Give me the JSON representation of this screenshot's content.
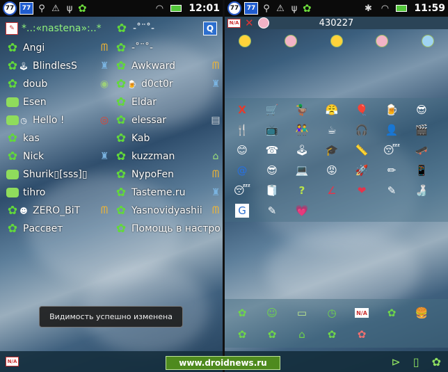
{
  "left": {
    "status": {
      "time": "12:01",
      "badge": "77"
    },
    "header": {
      "self_name": "*..:«nastena»:..*",
      "second_name": "-˚¨˚-",
      "q_label": "Q"
    },
    "column1": [
      {
        "name": "Angi",
        "icon": "icq-flower-online",
        "extra": "mm"
      },
      {
        "name": "BlindlesS",
        "icon": "icq-flower-online",
        "sub": "joystick",
        "extra": "ph"
      },
      {
        "name": "doub",
        "icon": "icq-flower-online",
        "extra": "eye"
      },
      {
        "name": "Esen",
        "icon": "chat-bubble",
        "extra": ""
      },
      {
        "name": "Hello !",
        "icon": "chat-bubble",
        "sub": "clock",
        "extra": "target"
      },
      {
        "name": "kas",
        "icon": "icq-flower-online",
        "extra": ""
      },
      {
        "name": "Nick",
        "icon": "icq-flower-online",
        "extra": "ph"
      },
      {
        "name": "Shurik▯[sss]▯",
        "icon": "chat-bubble",
        "extra": ""
      },
      {
        "name": "tihro",
        "icon": "chat-bubble",
        "extra": ""
      },
      {
        "name": "ZERO_BiT",
        "icon": "icq-flower-online",
        "sub": "smiley",
        "extra": "mm"
      },
      {
        "name": "Рассвет",
        "icon": "icq-flower-online",
        "extra": ""
      }
    ],
    "column2": [
      {
        "name": "-˚¨˚-",
        "icon": "icq-flower-online",
        "extra": ""
      },
      {
        "name": "Awkward",
        "icon": "icq-flower-online",
        "extra": "mm"
      },
      {
        "name": "d0ct0r",
        "icon": "icq-flower-online",
        "sub": "beer",
        "extra": "ph"
      },
      {
        "name": "Eldar",
        "icon": "icq-flower-online",
        "extra": ""
      },
      {
        "name": "elessar",
        "icon": "icq-flower-online",
        "extra": "phone"
      },
      {
        "name": "Kab",
        "icon": "icq-flower-online",
        "extra": ""
      },
      {
        "name": "kuzzman",
        "icon": "icq-flower-online",
        "extra": "01"
      },
      {
        "name": "NypoFen",
        "icon": "icq-flower-online",
        "extra": "mm"
      },
      {
        "name": "Tasteme.ru",
        "icon": "icq-flower-online",
        "extra": "ph"
      },
      {
        "name": "Yasnovidyashii",
        "icon": "icq-flower-online",
        "extra": "mm"
      },
      {
        "name": "Помощь в настро",
        "icon": "icq-flower-online",
        "extra": ""
      }
    ],
    "toast": "Видимость успешно изменена",
    "bottom_badge": "N/A"
  },
  "watermark": "www.droidnews.ru",
  "right": {
    "status": {
      "time": "11:59",
      "badge": "77"
    },
    "top_bar": {
      "badge": "N/A",
      "uin": "430227"
    },
    "status_faces": [
      "face-1",
      "face-2",
      "face-3",
      "face-4",
      "face-5"
    ],
    "xstatus_rows": [
      [
        "X",
        "🛒",
        "🦆",
        "😤",
        "🎈",
        "🍺",
        "😎"
      ],
      [
        "🍴",
        "📺",
        "👫",
        "☕",
        "🎧",
        "👤",
        "🎬"
      ],
      [
        "😊",
        "☎",
        "🕹",
        "🎓",
        "📏",
        "😴",
        "🛹"
      ],
      [
        "@",
        "😎",
        "💻",
        "😡",
        "🚀",
        "✏",
        "📱"
      ],
      [
        "😴",
        "🧻",
        "?",
        "∠",
        "❤",
        "✎",
        "🍶"
      ],
      [
        "G",
        "✎",
        "💗"
      ]
    ],
    "status_rows": [
      [
        "online",
        "free-for-chat",
        "away",
        "dnd",
        "N/A",
        "invisible",
        "lunch"
      ],
      [
        "evil",
        "depressed",
        "home",
        "work",
        "offline"
      ]
    ]
  }
}
